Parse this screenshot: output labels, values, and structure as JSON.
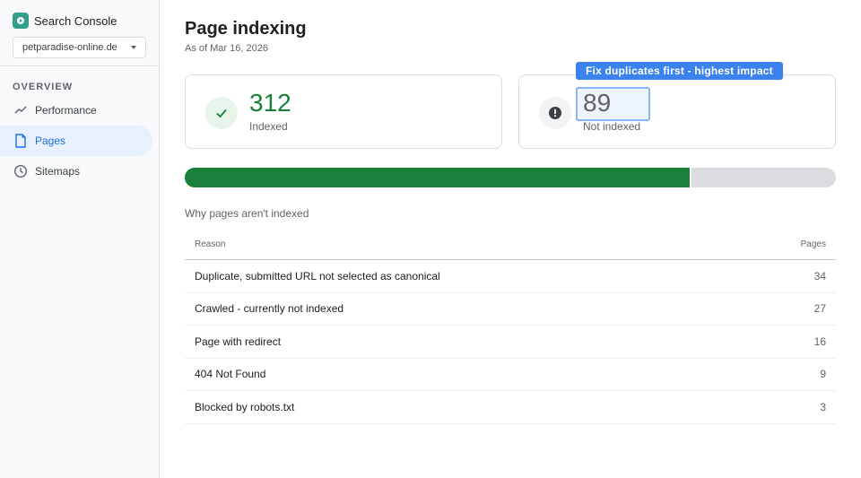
{
  "app": {
    "name": "Search Console",
    "property": "petparadise-online.de"
  },
  "sidebar": {
    "section": "OVERVIEW",
    "items": [
      {
        "label": "Performance",
        "icon": "trend-icon",
        "active": false
      },
      {
        "label": "Pages",
        "icon": "document-icon",
        "active": true
      },
      {
        "label": "Sitemaps",
        "icon": "clock-icon",
        "active": false
      }
    ]
  },
  "page": {
    "title": "Page indexing",
    "subtitle": "As of Mar 16, 2026"
  },
  "summary": {
    "indexed": {
      "value": "312",
      "label": "Indexed",
      "icon": "check-icon",
      "color": "#188038"
    },
    "not_indexed": {
      "value": "89",
      "label": "Not indexed",
      "icon": "alert-icon",
      "color": "#5f6368"
    }
  },
  "annotation": {
    "text": "Fix duplicates first - highest impact",
    "color": "#3b82ee"
  },
  "progress": {
    "indexed_fraction": 0.778
  },
  "reasons": {
    "title": "Why pages aren't indexed",
    "columns": [
      "Reason",
      "Pages"
    ],
    "rows": [
      {
        "reason": "Duplicate, submitted URL not selected as canonical",
        "pages": "34"
      },
      {
        "reason": "Crawled - currently not indexed",
        "pages": "27"
      },
      {
        "reason": "Page with redirect",
        "pages": "16"
      },
      {
        "reason": "404 Not Found",
        "pages": "9"
      },
      {
        "reason": "Blocked by robots.txt",
        "pages": "3"
      }
    ]
  }
}
